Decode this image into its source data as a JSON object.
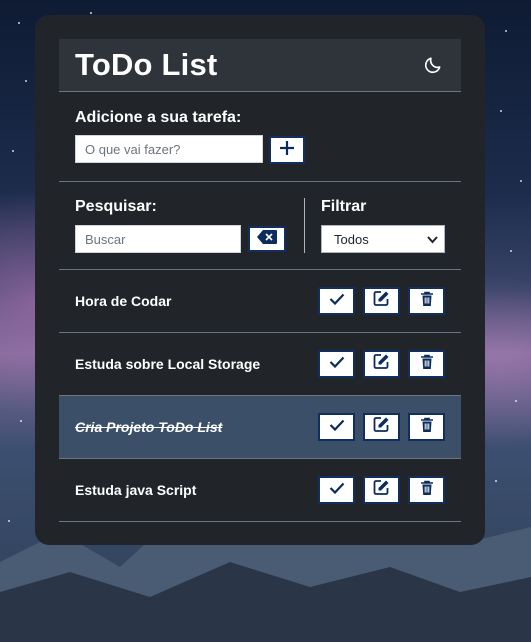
{
  "app": {
    "title": "ToDo List",
    "theme_icon": "moon-icon"
  },
  "add_section": {
    "label": "Adicione a sua tarefa:",
    "input_value": "",
    "input_placeholder": "O que vai fazer?",
    "add_icon": "plus-icon"
  },
  "search_section": {
    "label": "Pesquisar:",
    "input_value": "",
    "input_placeholder": "Buscar",
    "clear_icon": "backspace-icon"
  },
  "filter_section": {
    "label": "Filtrar",
    "selected": "Todos"
  },
  "todos": [
    {
      "text": "Hora de Codar",
      "done": false
    },
    {
      "text": "Estuda sobre Local Storage",
      "done": false
    },
    {
      "text": "Cria Projeto ToDo List",
      "done": true
    },
    {
      "text": "Estuda java Script",
      "done": false
    }
  ],
  "todo_action_icons": [
    "check-icon",
    "edit-icon",
    "trash-icon"
  ],
  "colors": {
    "card_bg": "#212529",
    "header_bg": "#2e3439",
    "done_row_bg": "#3b5068",
    "button_border": "#102f5e",
    "icon_color": "#0c2d5c"
  }
}
